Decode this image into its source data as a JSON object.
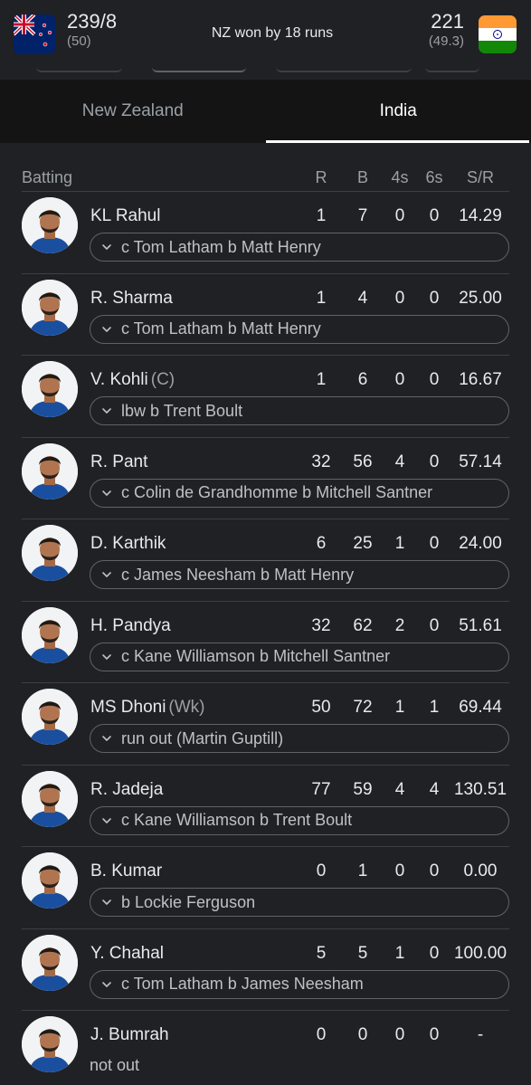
{
  "match": {
    "team1": {
      "name": "New Zealand",
      "score": "239/8",
      "overs": "(50)",
      "flag": "nz-flag-icon"
    },
    "team2": {
      "name": "India",
      "score": "221",
      "overs": "(49.3)",
      "flag": "india-flag-icon"
    },
    "result": "NZ won by 18 runs"
  },
  "tabs": [
    {
      "label": "New Zealand",
      "active": false
    },
    {
      "label": "India",
      "active": true
    }
  ],
  "batting": {
    "header": {
      "title": "Batting",
      "r": "R",
      "b": "B",
      "fours": "4s",
      "sixes": "6s",
      "sr": "S/R"
    },
    "players": [
      {
        "name": "KL Rahul",
        "role": "",
        "r": "1",
        "b": "7",
        "fours": "0",
        "sixes": "0",
        "sr": "14.29",
        "dismissal": "c Tom Latham b Matt Henry",
        "out": true
      },
      {
        "name": "R. Sharma",
        "role": "",
        "r": "1",
        "b": "4",
        "fours": "0",
        "sixes": "0",
        "sr": "25.00",
        "dismissal": "c Tom Latham b Matt Henry",
        "out": true
      },
      {
        "name": "V. Kohli",
        "role": "(C)",
        "r": "1",
        "b": "6",
        "fours": "0",
        "sixes": "0",
        "sr": "16.67",
        "dismissal": "lbw b Trent Boult",
        "out": true
      },
      {
        "name": "R. Pant",
        "role": "",
        "r": "32",
        "b": "56",
        "fours": "4",
        "sixes": "0",
        "sr": "57.14",
        "dismissal": "c Colin de Grandhomme b Mitchell Santner",
        "out": true
      },
      {
        "name": "D. Karthik",
        "role": "",
        "r": "6",
        "b": "25",
        "fours": "1",
        "sixes": "0",
        "sr": "24.00",
        "dismissal": "c James Neesham b Matt Henry",
        "out": true
      },
      {
        "name": "H. Pandya",
        "role": "",
        "r": "32",
        "b": "62",
        "fours": "2",
        "sixes": "0",
        "sr": "51.61",
        "dismissal": "c Kane Williamson b Mitchell Santner",
        "out": true
      },
      {
        "name": "MS Dhoni",
        "role": "(Wk)",
        "r": "50",
        "b": "72",
        "fours": "1",
        "sixes": "1",
        "sr": "69.44",
        "dismissal": "run out (Martin Guptill)",
        "out": true
      },
      {
        "name": "R. Jadeja",
        "role": "",
        "r": "77",
        "b": "59",
        "fours": "4",
        "sixes": "4",
        "sr": "130.51",
        "dismissal": "c Kane Williamson b Trent Boult",
        "out": true
      },
      {
        "name": "B. Kumar",
        "role": "",
        "r": "0",
        "b": "1",
        "fours": "0",
        "sixes": "0",
        "sr": "0.00",
        "dismissal": "b Lockie Ferguson",
        "out": true
      },
      {
        "name": "Y. Chahal",
        "role": "",
        "r": "5",
        "b": "5",
        "fours": "1",
        "sixes": "0",
        "sr": "100.00",
        "dismissal": "c Tom Latham b James Neesham",
        "out": true
      },
      {
        "name": "J. Bumrah",
        "role": "",
        "r": "0",
        "b": "0",
        "fours": "0",
        "sixes": "0",
        "sr": "-",
        "dismissal": "not out",
        "out": false
      }
    ]
  },
  "colors": {
    "background": "#202124",
    "tabs_bg": "#141414",
    "text": "#e8eaed",
    "muted": "#9aa0a6",
    "divider": "#3c4043",
    "india_jersey": "#1a4fa0"
  },
  "icons": {
    "dismissal_toggle": "chevron-down-icon",
    "player_photo": "player-avatar"
  }
}
